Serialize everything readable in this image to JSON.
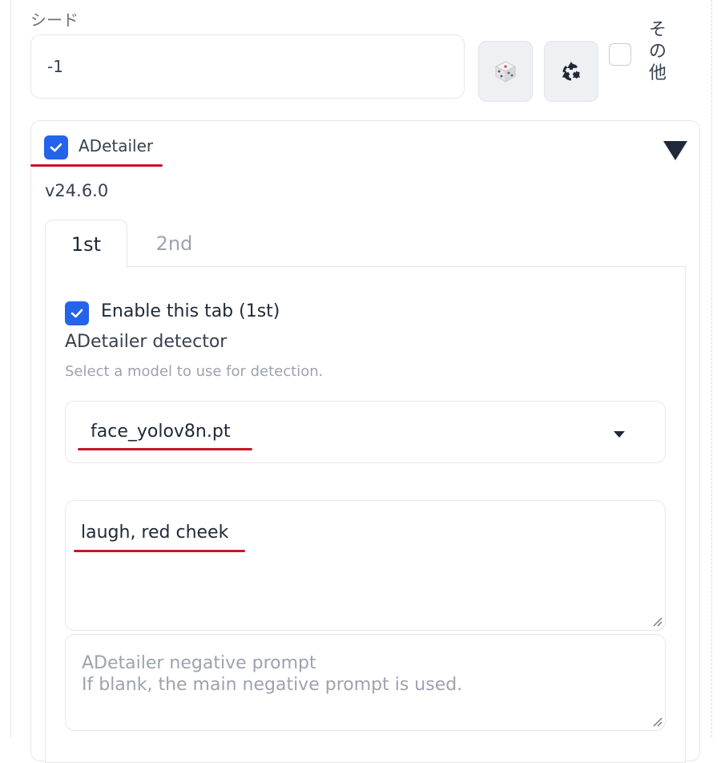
{
  "seed": {
    "label": "シード",
    "value": "-1",
    "other_label": "その他"
  },
  "icons": {
    "dice": "dice-icon",
    "recycle": "recycle-icon"
  },
  "adetailer": {
    "label": "ADetailer",
    "version": "v24.6.0",
    "enabled": true,
    "tabs": [
      {
        "label": "1st",
        "active": true
      },
      {
        "label": "2nd",
        "active": false
      }
    ],
    "enable_tab_label": "Enable this tab (1st)",
    "detector_label": "ADetailer detector",
    "detector_info": "Select a model to use for detection.",
    "detector_value": "face_yolov8n.pt",
    "prompt_value": "laugh, red cheek",
    "negative_placeholder": "ADetailer negative prompt\nIf blank, the main negative prompt is used."
  },
  "colors": {
    "accent": "#2563eb",
    "annotation_underline": "#c4162a"
  }
}
